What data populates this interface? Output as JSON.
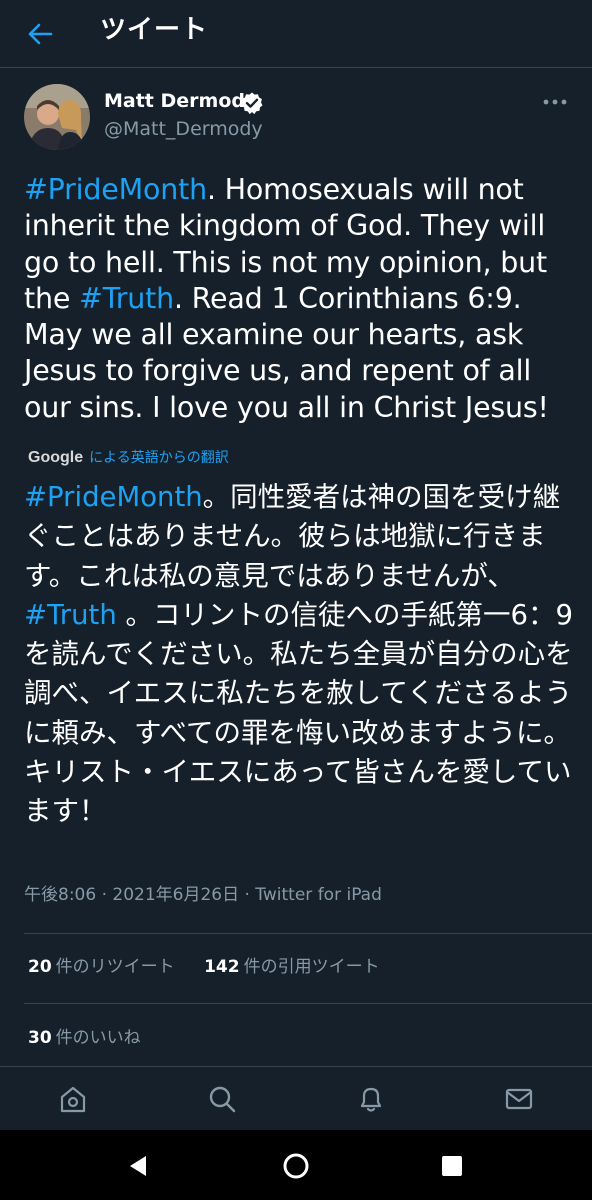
{
  "header": {
    "title": "ツイート",
    "back_icon": "arrow-left-icon"
  },
  "author": {
    "name": "Matt Dermody",
    "handle": "@Matt_Dermody",
    "verified": true,
    "verified_icon": "verified-badge-icon",
    "more_icon": "more-options-icon"
  },
  "tweet": {
    "text_segments": [
      {
        "text": "#PrideMonth",
        "tag": true
      },
      {
        "text": ". Homosexuals will not inherit the kingdom of God. They will go to hell. This is not my opinion, but the ",
        "tag": false
      },
      {
        "text": "#Truth",
        "tag": true
      },
      {
        "text": ". Read 1 Corinthians 6:9. May we all examine our hearts, ask Jesus to forgive us, and repent of all our sins. I love you all in Christ Jesus!",
        "tag": false
      }
    ],
    "translation_source": "Google",
    "translation_label": "による英語からの翻訳",
    "translated_segments": [
      {
        "text": "#PrideMonth",
        "tag": true
      },
      {
        "text": "。同性愛者は神の国を受け継ぐことはありません。彼らは地獄に行きます。これは私の意見ではありませんが、",
        "tag": false
      },
      {
        "text": "#Truth",
        "tag": true
      },
      {
        "text": " 。コリントの信徒への手紙第一6：9を読んでください。私たち全員が自分の心を調べ、イエスに私たちを赦してくださるように頼み、すべての罪を悔い改めますように。キリスト・イエスにあって皆さんを愛しています！",
        "tag": false
      }
    ],
    "meta": "午後8:06 · 2021年6月26日 · Twitter for iPad"
  },
  "stats": {
    "retweets_count": "20",
    "retweets_label": "件のリツイート",
    "quotes_count": "142",
    "quotes_label": "件の引用ツイート",
    "likes_count": "30",
    "likes_label": "件のいいね"
  },
  "bottom_nav": {
    "items": [
      "home-icon",
      "search-icon",
      "notifications-bell-icon",
      "messages-envelope-icon"
    ]
  },
  "system_nav": {
    "items": [
      "back-triangle-icon",
      "home-circle-icon",
      "recents-square-icon"
    ]
  },
  "colors": {
    "background": "#15202b",
    "accent": "#1da1f2",
    "secondary_text": "#8899a6",
    "divider": "#38444d"
  }
}
